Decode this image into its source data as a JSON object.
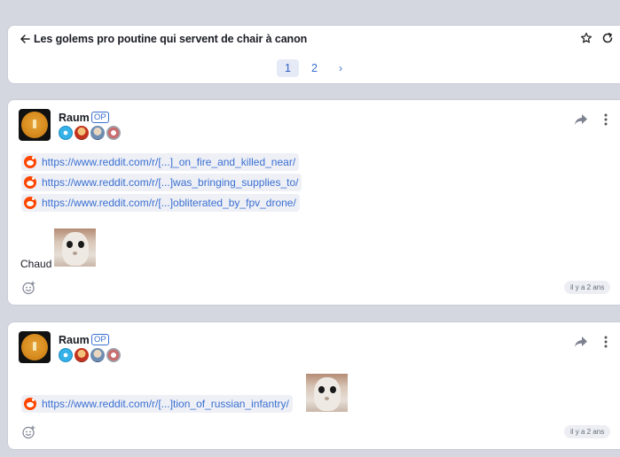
{
  "topic": {
    "title": "Les golems pro poutine qui servent de chair à canon"
  },
  "pagination": {
    "pages": [
      "1",
      "2"
    ],
    "active": "1",
    "next": "›"
  },
  "posts": [
    {
      "author": "Raum",
      "op_label": "OP",
      "links": [
        "https://www.reddit.com/r/[...]_on_fire_and_killed_near/",
        "https://www.reddit.com/r/[...]was_bringing_supplies_to/",
        "https://www.reddit.com/r/[...]obliterated_by_fpv_drone/"
      ],
      "caption": "Chaud",
      "time": "il y a 2 ans"
    },
    {
      "author": "Raum",
      "op_label": "OP",
      "links": [
        "https://www.reddit.com/r/[...]tion_of_russian_infantry/"
      ],
      "time": "il y a 2 ans"
    }
  ],
  "colors": {
    "accent": "#3a6fd1",
    "background": "#d5d7e0",
    "reddit": "#ff4500"
  },
  "icons": [
    "back-arrow-icon",
    "star-icon",
    "refresh-icon",
    "share-icon",
    "more-vertical-icon",
    "reddit-icon",
    "emoji-react-icon"
  ]
}
